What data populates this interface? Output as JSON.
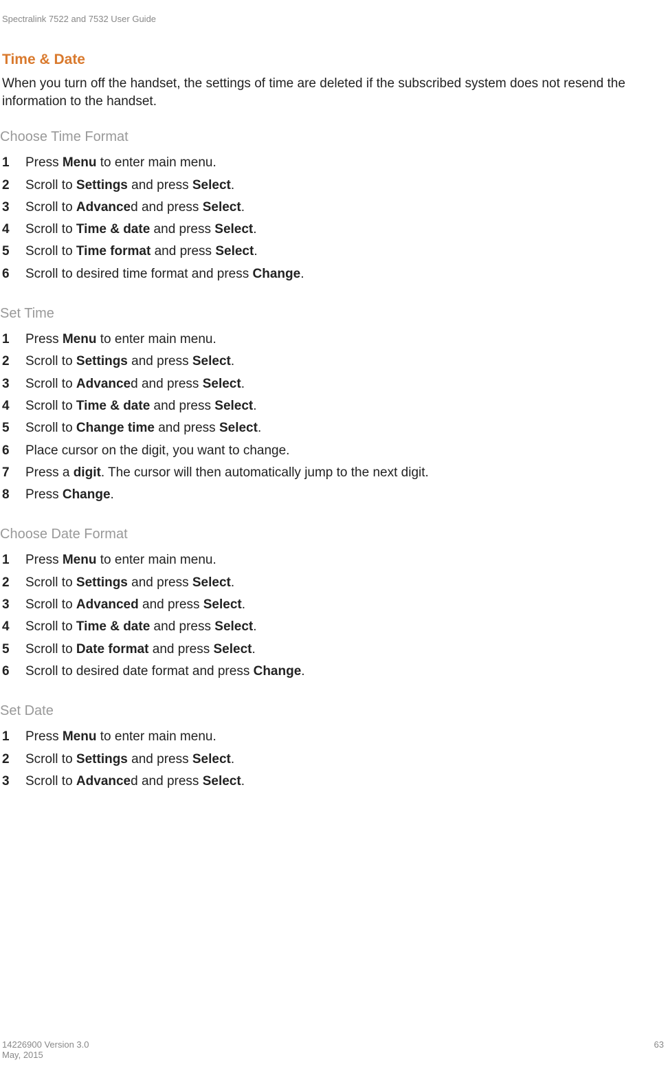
{
  "header": "Spectralink 7522 and 7532 User Guide",
  "title": "Time & Date",
  "intro": "When you turn off the handset, the settings of time are deleted if the subscribed system does not resend the information to the handset.",
  "sections": [
    {
      "title": "Choose Time Format",
      "steps": [
        "Press <b>Menu</b> to enter main menu.",
        "Scroll to <b>Settings</b> and press <b>Select</b>.",
        "Scroll to <b>Advance</b>d and press <b>Select</b>.",
        "Scroll to <b>Time & date</b> and press <b>Select</b>.",
        "Scroll to <b>Time format</b> and press <b>Select</b>.",
        "Scroll to desired time format and press <b>Change</b>."
      ]
    },
    {
      "title": "Set Time",
      "steps": [
        "Press <b>Menu</b> to enter main menu.",
        "Scroll to <b>Settings</b> and press <b>Select</b>.",
        "Scroll to <b>Advance</b>d and press <b>Select</b>.",
        "Scroll to <b>Time & date</b> and press <b>Select</b>.",
        "Scroll to <b>Change time</b> and press <b>Select</b>.",
        "Place cursor on the digit, you want to change.",
        "Press a <b>digit</b>. The cursor will then automatically jump to the next digit.",
        "Press <b>Change</b>."
      ]
    },
    {
      "title": "Choose Date Format",
      "steps": [
        "Press <b>Menu</b> to enter main menu.",
        "Scroll to <b>Settings</b> and press <b>Select</b>.",
        "Scroll to <b>Advanced</b> and press <b>Select</b>.",
        "Scroll to <b>Time & date</b> and press <b>Select</b>.",
        "Scroll to <b>Date format</b> and press <b>Select</b>.",
        "Scroll to desired date format and press <b>Change</b>."
      ]
    },
    {
      "title": "Set Date",
      "steps": [
        "Press <b>Menu</b> to enter main menu.",
        "Scroll to <b>Settings</b> and press <b>Select</b>.",
        "Scroll to <b>Advance</b>d and press <b>Select</b>."
      ]
    }
  ],
  "footer": {
    "version": "14226900 Version 3.0",
    "date": "May, 2015",
    "page": "63"
  }
}
